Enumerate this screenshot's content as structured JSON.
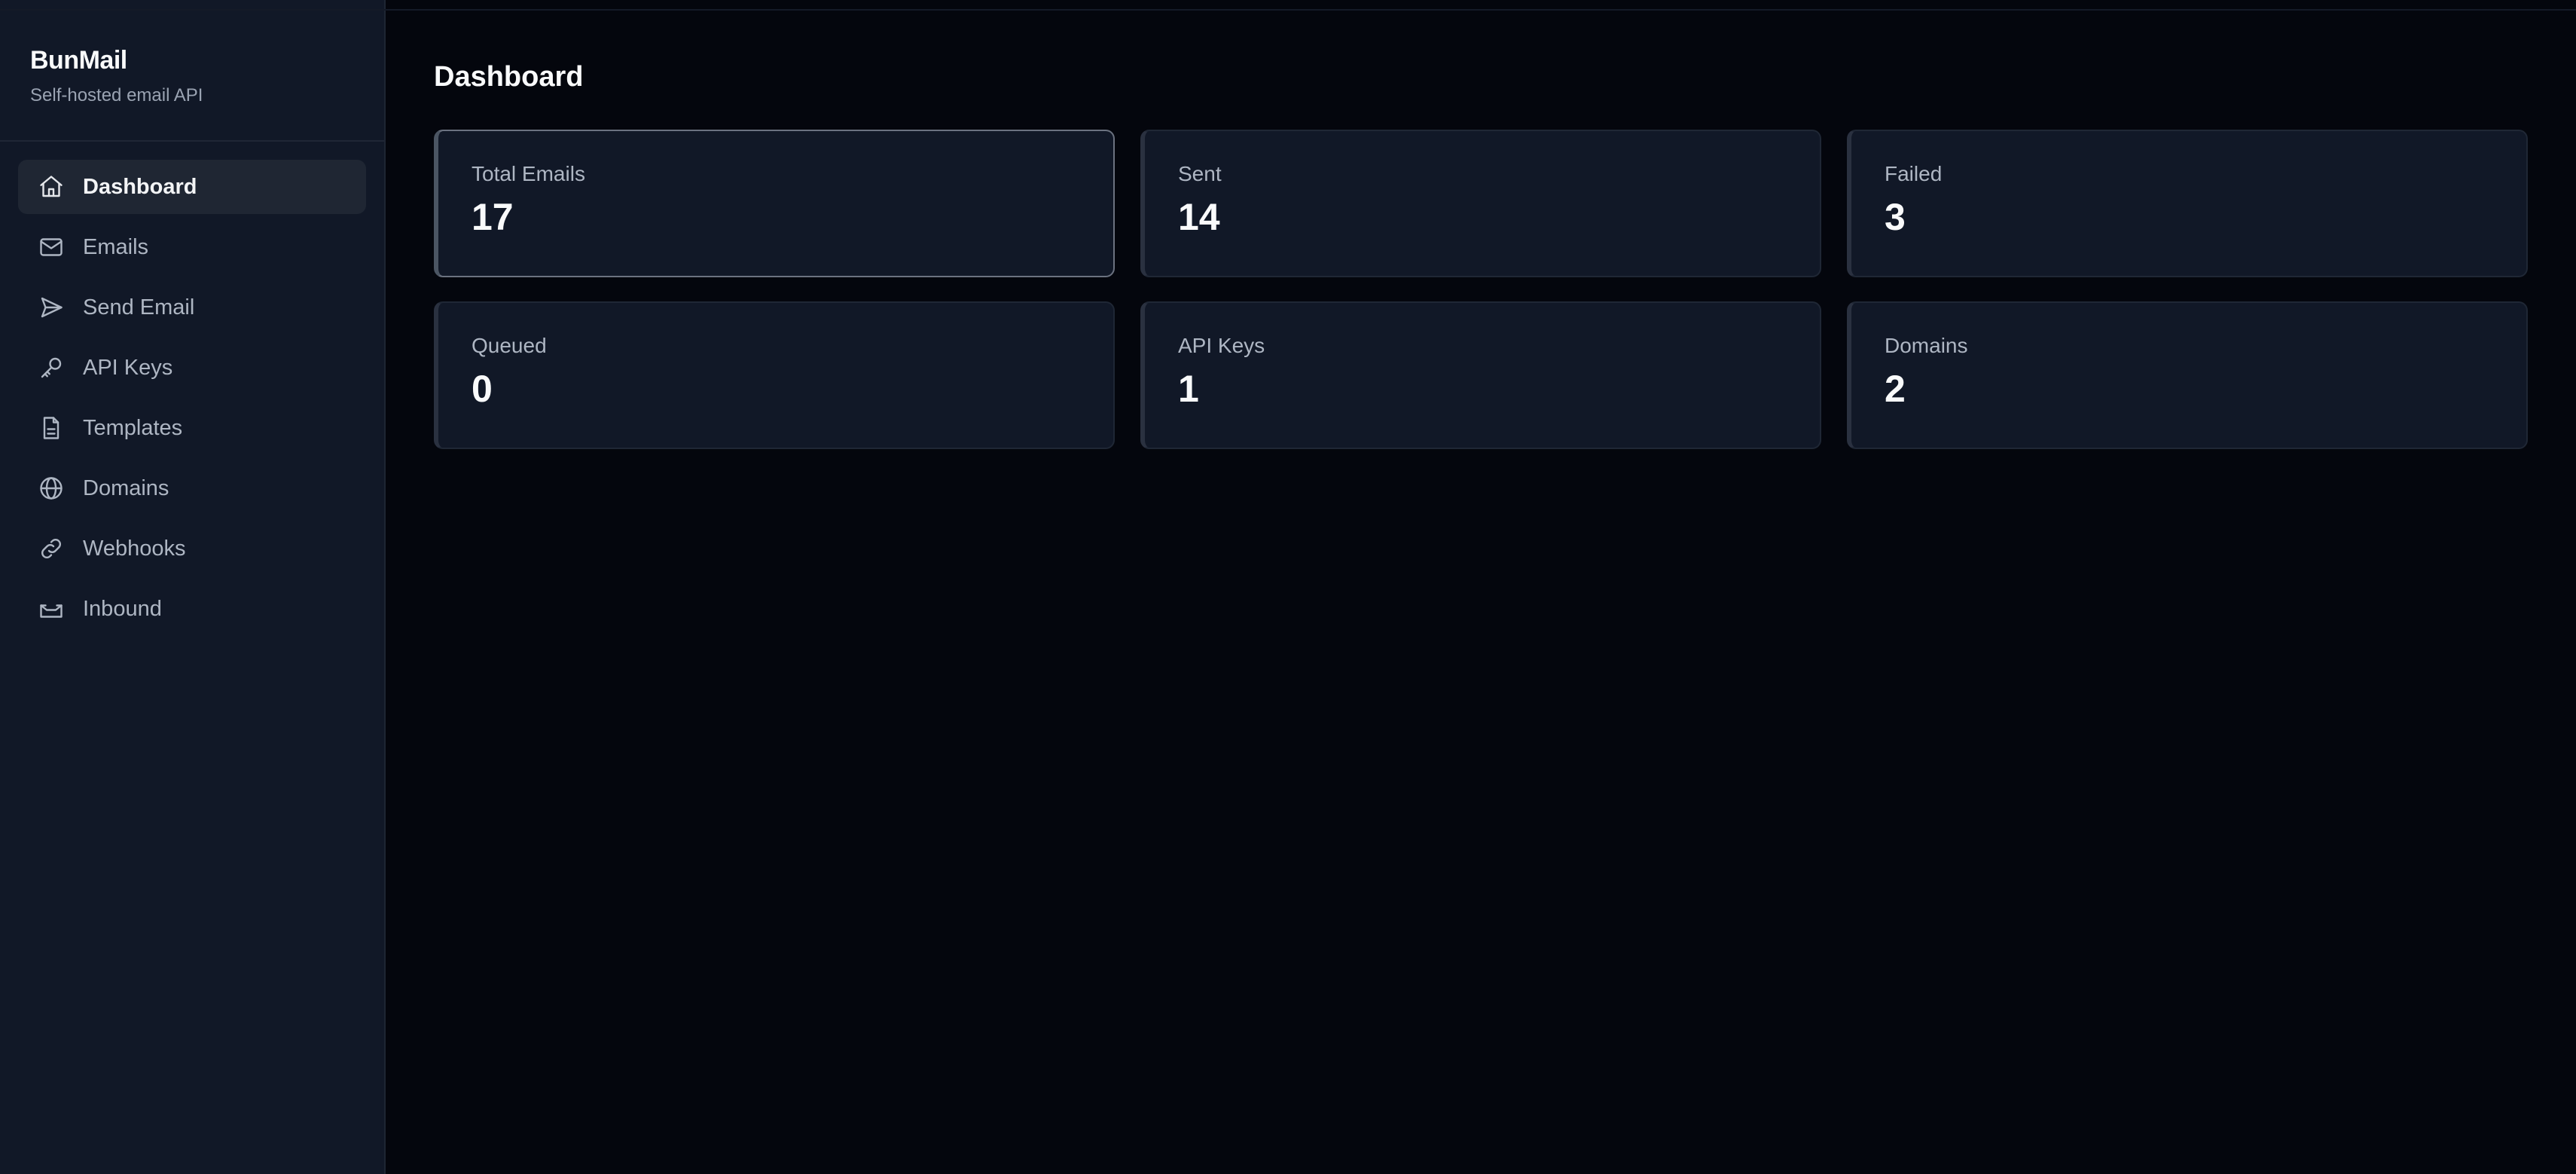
{
  "brand": {
    "title": "BunMail",
    "subtitle": "Self-hosted email API"
  },
  "sidebar": {
    "items": [
      {
        "label": "Dashboard",
        "icon": "home-icon",
        "active": true
      },
      {
        "label": "Emails",
        "icon": "mail-icon",
        "active": false
      },
      {
        "label": "Send Email",
        "icon": "send-icon",
        "active": false
      },
      {
        "label": "API Keys",
        "icon": "key-icon",
        "active": false
      },
      {
        "label": "Templates",
        "icon": "file-icon",
        "active": false
      },
      {
        "label": "Domains",
        "icon": "globe-icon",
        "active": false
      },
      {
        "label": "Webhooks",
        "icon": "link-icon",
        "active": false
      },
      {
        "label": "Inbound",
        "icon": "inbox-icon",
        "active": false
      }
    ]
  },
  "main": {
    "title": "Dashboard",
    "stats": [
      {
        "label": "Total Emails",
        "value": "17"
      },
      {
        "label": "Sent",
        "value": "14"
      },
      {
        "label": "Failed",
        "value": "3"
      },
      {
        "label": "Queued",
        "value": "0"
      },
      {
        "label": "API Keys",
        "value": "1"
      },
      {
        "label": "Domains",
        "value": "2"
      }
    ]
  },
  "colors": {
    "background": "#04060d",
    "sidebar": "#111827",
    "card": "#111827",
    "active_item": "#1f2633"
  }
}
